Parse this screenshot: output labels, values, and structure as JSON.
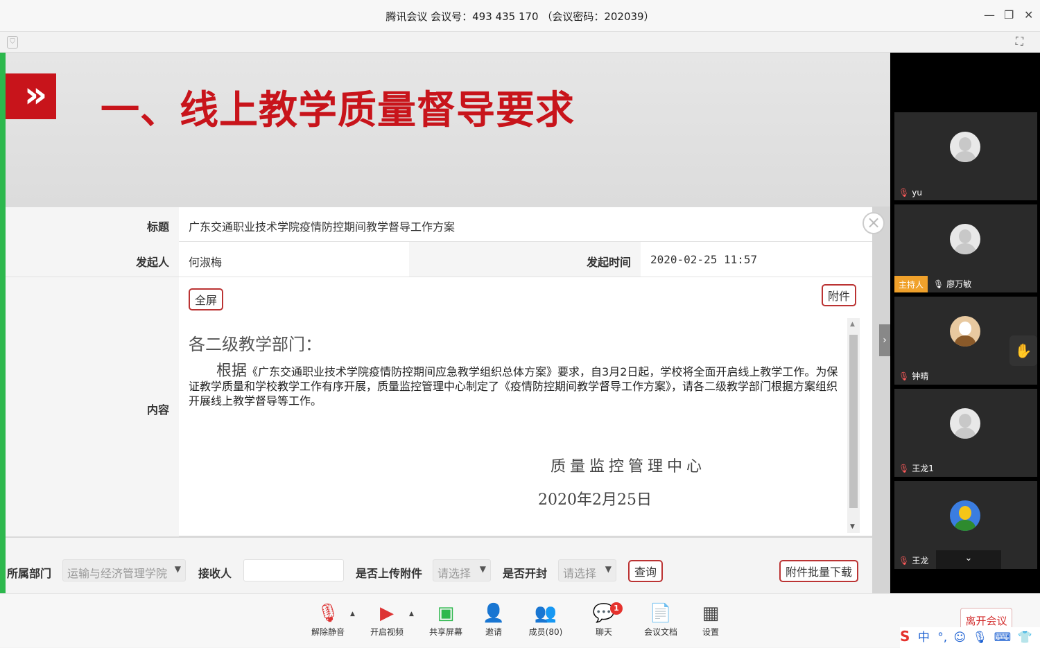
{
  "window": {
    "title": "腾讯会议 会议号：493 435 170 （会议密码：202039）"
  },
  "slide": {
    "title": "一、线上教学质量督导要求"
  },
  "form": {
    "title_label": "标题",
    "title_value": "广东交通职业技术学院疫情防控期间教学督导工作方案",
    "sender_label": "发起人",
    "sender_value": "何淑梅",
    "time_label": "发起时间",
    "time_value": "2020-02-25 11:57",
    "content_label": "内容",
    "fullscreen_button": "全屏",
    "attach_button": "附件",
    "doc_greeting": "各二级教学部门：",
    "doc_body_lead": "根据",
    "doc_body": "《广东交通职业技术学院疫情防控期间应急教学组织总体方案》要求，自3月2日起，学校将全面开启线上教学工作。为保证教学质量和学校教学工作有序开展，质量监控管理中心制定了《疫情防控期间教学督导工作方案》，请各二级教学部门根据方案组织开展线上教学督导等工作。",
    "doc_signature": "质量监控管理中心",
    "doc_date": "2020年2月25日"
  },
  "filter": {
    "dept_label": "所属部门",
    "dept_value": "运输与经济管理学院",
    "receiver_label": "接收人",
    "receiver_value": "",
    "upload_label": "是否上传附件",
    "upload_value": "请选择",
    "open_label": "是否开封",
    "open_value": "请选择",
    "query_button": "查询",
    "batch_button": "附件批量下载"
  },
  "participants": [
    {
      "name": "yu",
      "host": ""
    },
    {
      "name": "廖万敏",
      "host": "主持人"
    },
    {
      "name": "钟晴",
      "host": ""
    },
    {
      "name": "王龙1",
      "host": ""
    },
    {
      "name": "王龙",
      "host": ""
    }
  ],
  "toolbar": {
    "unmute": "解除静音",
    "video": "开启视频",
    "share": "共享屏幕",
    "invite": "邀请",
    "members": "成员(80)",
    "chat": "聊天",
    "chat_badge": "1",
    "docs": "会议文档",
    "settings": "设置",
    "leave": "离开会议"
  },
  "ime": {
    "label": "中"
  }
}
